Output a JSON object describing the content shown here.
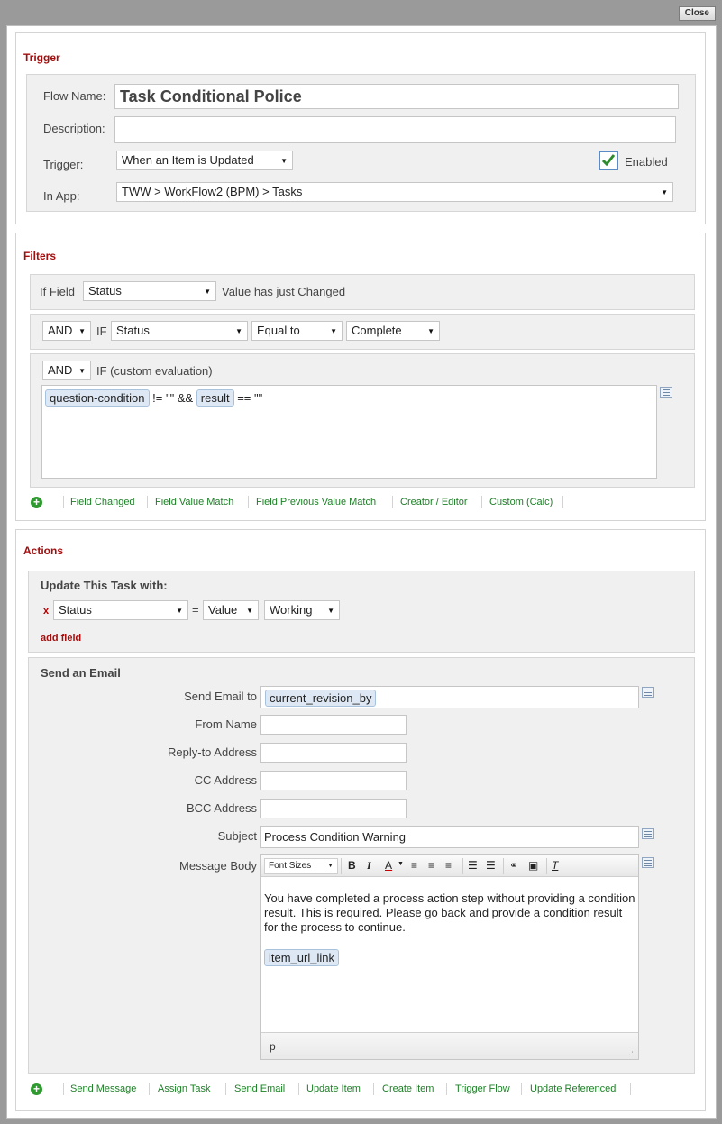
{
  "window": {
    "close_label": "Close"
  },
  "trigger": {
    "title": "Trigger",
    "flow_name_label": "Flow Name:",
    "flow_name_value": "Task Conditional Police",
    "description_label": "Description:",
    "description_value": "",
    "trigger_label": "Trigger:",
    "trigger_value": "When an Item is Updated",
    "enabled_label": "Enabled",
    "enabled_checked": true,
    "app_label": "In App:",
    "app_value": "TWW > WorkFlow2 (BPM) > Tasks"
  },
  "filters": {
    "title": "Filters",
    "row1": {
      "if_field_label": "If Field",
      "field_value": "Status",
      "suffix": "Value has just Changed"
    },
    "row2": {
      "conj": "AND",
      "if_label": "IF",
      "field": "Status",
      "operator": "Equal to",
      "value": "Complete"
    },
    "row3": {
      "conj": "AND",
      "label": "IF (custom evaluation)",
      "token1": "question-condition",
      "text1": "!= \"\" &&",
      "token2": "result",
      "text2": "== \"\""
    },
    "links": [
      "Field Changed",
      "Field Value Match",
      "Field Previous Value Match",
      "Creator / Editor",
      "Custom (Calc)"
    ]
  },
  "actions": {
    "title": "Actions",
    "update": {
      "title": "Update This Task with:",
      "remove": "x",
      "field": "Status",
      "equals": "=",
      "type": "Value",
      "value": "Working",
      "add_field": "add field"
    },
    "email": {
      "title": "Send an Email",
      "to_label": "Send Email to",
      "to_token": "current_revision_by",
      "from_label": "From Name",
      "reply_label": "Reply-to Address",
      "cc_label": "CC Address",
      "bcc_label": "BCC Address",
      "subject_label": "Subject",
      "subject_value": "Process Condition Warning",
      "body_label": "Message Body",
      "font_sizes": "Font Sizes",
      "body_text": "You have completed a process action step without providing a condition result. This is required. Please go back and provide a condition result for the process to continue.",
      "body_token": "item_url_link",
      "status_path": "p"
    },
    "links": [
      "Send Message",
      "Assign Task",
      "Send Email",
      "Update Item",
      "Create Item",
      "Trigger Flow",
      "Update Referenced"
    ]
  }
}
